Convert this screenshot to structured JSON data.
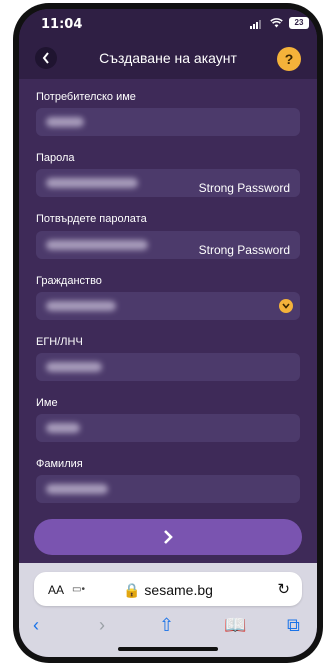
{
  "status": {
    "time": "11:04",
    "battery": "23"
  },
  "header": {
    "title": "Създаване на акаунт",
    "back_icon": "chevron-left-icon",
    "help_label": "?"
  },
  "form": {
    "username_label": "Потребителско име",
    "password_label": "Парола",
    "password_strength": "Strong Password",
    "confirm_label": "Потвърдете паролата",
    "confirm_strength": "Strong Password",
    "citizenship_label": "Гражданство",
    "egn_label": "ЕГН/ЛНЧ",
    "first_name_label": "Име",
    "last_name_label": "Фамилия",
    "next_label": "›"
  },
  "browser": {
    "aa_label": "AA",
    "url": "sesame.bg",
    "reload_icon": "reload-icon"
  },
  "colors": {
    "background": "#3e2a58",
    "accent": "#f4b23a",
    "button": "#7a54b0"
  }
}
